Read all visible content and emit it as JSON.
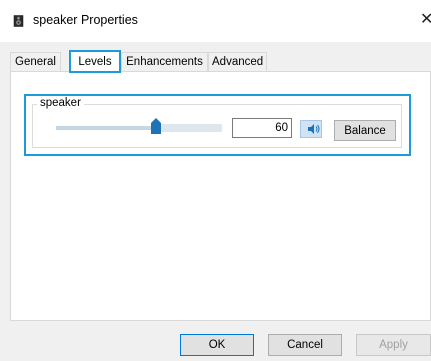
{
  "window": {
    "title": "speaker Properties",
    "close_glyph": "✕",
    "icon": "speaker-icon"
  },
  "tabs": [
    {
      "label": "General",
      "selected": false
    },
    {
      "label": "Levels",
      "selected": true
    },
    {
      "label": "Enhancements",
      "selected": false
    },
    {
      "label": "Advanced",
      "selected": false
    }
  ],
  "levels": {
    "group_label": "speaker",
    "volume": "60",
    "volume_fraction": 0.6,
    "mute_icon": "speaker-volume-icon",
    "balance_label": "Balance"
  },
  "footer": {
    "ok_label": "OK",
    "cancel_label": "Cancel",
    "apply_label": "Apply"
  },
  "colors": {
    "highlight": "#1e9bd7",
    "thumb": "#1c73b8",
    "panel": "#ffffff",
    "dialog_bg": "#f0f0f0"
  }
}
